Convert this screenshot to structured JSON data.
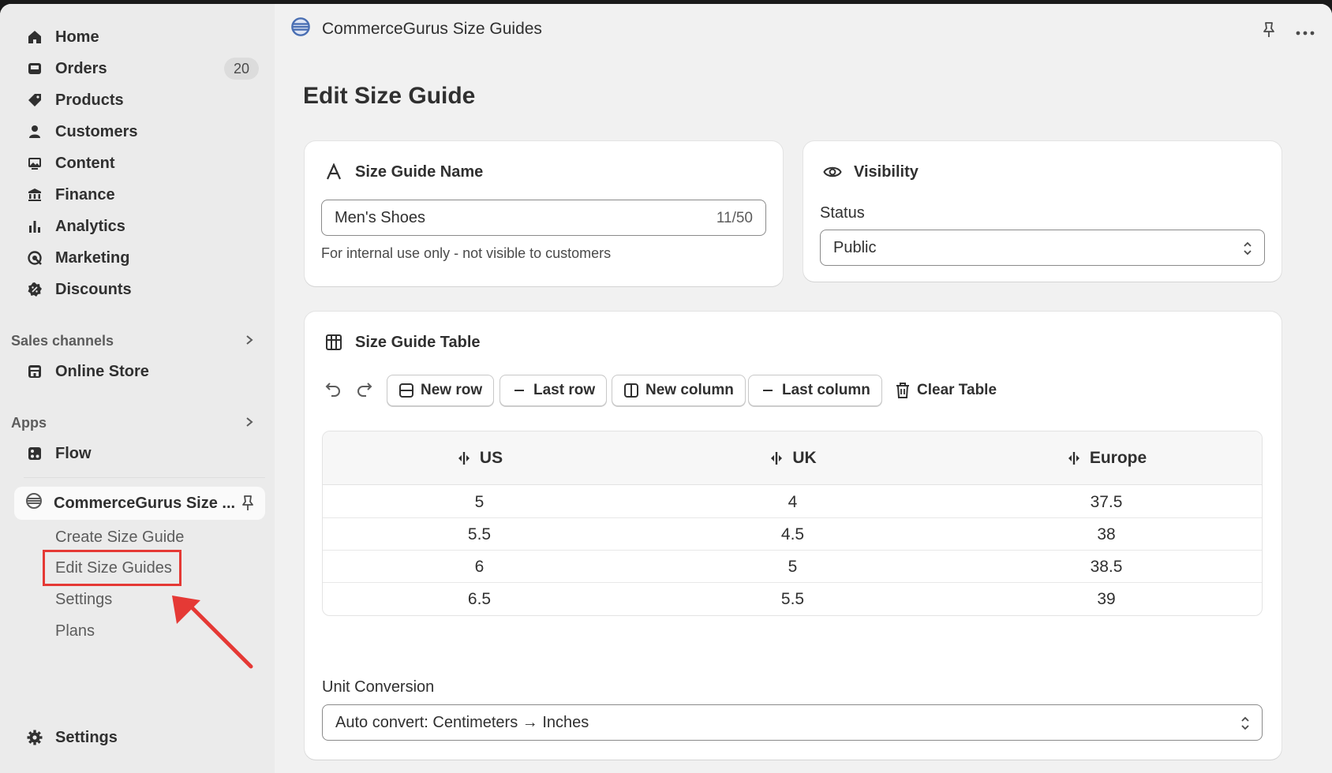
{
  "sidebar": {
    "nav": [
      {
        "label": "Home",
        "icon": "home-icon"
      },
      {
        "label": "Orders",
        "icon": "inbox-icon",
        "badge": "20"
      },
      {
        "label": "Products",
        "icon": "tag-icon"
      },
      {
        "label": "Customers",
        "icon": "person-icon"
      },
      {
        "label": "Content",
        "icon": "image-icon"
      },
      {
        "label": "Finance",
        "icon": "bank-icon"
      },
      {
        "label": "Analytics",
        "icon": "bar-chart-icon"
      },
      {
        "label": "Marketing",
        "icon": "target-icon"
      },
      {
        "label": "Discounts",
        "icon": "discount-icon"
      }
    ],
    "sales_channels": {
      "title": "Sales channels",
      "items": [
        {
          "label": "Online Store",
          "icon": "store-icon"
        }
      ]
    },
    "apps": {
      "title": "Apps",
      "items": [
        {
          "label": "Flow",
          "icon": "flow-icon"
        }
      ]
    },
    "active_app": {
      "label": "CommerceGurus Size ...",
      "subitems": [
        "Create Size Guide",
        "Edit Size Guides",
        "Settings",
        "Plans"
      ]
    },
    "settings_label": "Settings"
  },
  "topbar": {
    "app_title": "CommerceGurus Size Guides"
  },
  "page": {
    "title": "Edit Size Guide"
  },
  "name_card": {
    "title": "Size Guide Name",
    "value": "Men's Shoes",
    "counter": "11/50",
    "helper": "For internal use only - not visible to customers"
  },
  "visibility_card": {
    "title": "Visibility",
    "status_label": "Status",
    "status_value": "Public"
  },
  "table_card": {
    "title": "Size Guide Table",
    "buttons": {
      "new_row": "New row",
      "last_row": "Last row",
      "new_column": "New column",
      "last_column": "Last column",
      "clear_table": "Clear Table"
    },
    "columns": [
      "US",
      "UK",
      "Europe"
    ],
    "rows": [
      [
        "5",
        "4",
        "37.5"
      ],
      [
        "5.5",
        "4.5",
        "38"
      ],
      [
        "6",
        "5",
        "38.5"
      ],
      [
        "6.5",
        "5.5",
        "39"
      ]
    ],
    "unit_label": "Unit Conversion",
    "unit_value": "Auto convert: Centimeters → Inches"
  },
  "colors": {
    "highlight": "#e53935",
    "text": "#303030"
  }
}
